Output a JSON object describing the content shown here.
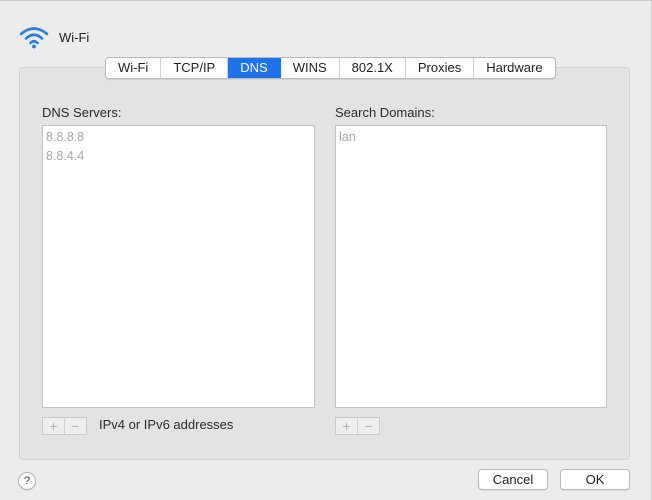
{
  "header": {
    "title": "Wi-Fi",
    "icon": "wifi-icon",
    "accent_color": "#2b7de1"
  },
  "tabs": [
    {
      "label": "Wi-Fi",
      "active": false
    },
    {
      "label": "TCP/IP",
      "active": false
    },
    {
      "label": "DNS",
      "active": true
    },
    {
      "label": "WINS",
      "active": false
    },
    {
      "label": "802.1X",
      "active": false
    },
    {
      "label": "Proxies",
      "active": false
    },
    {
      "label": "Hardware",
      "active": false
    }
  ],
  "dns": {
    "label": "DNS Servers:",
    "entries": [
      "8.8.8.8",
      "8.8.4.4"
    ],
    "hint": "IPv4 or IPv6 addresses"
  },
  "search": {
    "label": "Search Domains:",
    "entries": [
      "lan"
    ]
  },
  "controls": {
    "add_symbol": "+",
    "remove_symbol": "−"
  },
  "footer": {
    "help_symbol": "?",
    "cancel_label": "Cancel",
    "ok_label": "OK"
  },
  "colors": {
    "active_tab": "#1f72e8",
    "placeholder_text": "#a8a8a8"
  }
}
